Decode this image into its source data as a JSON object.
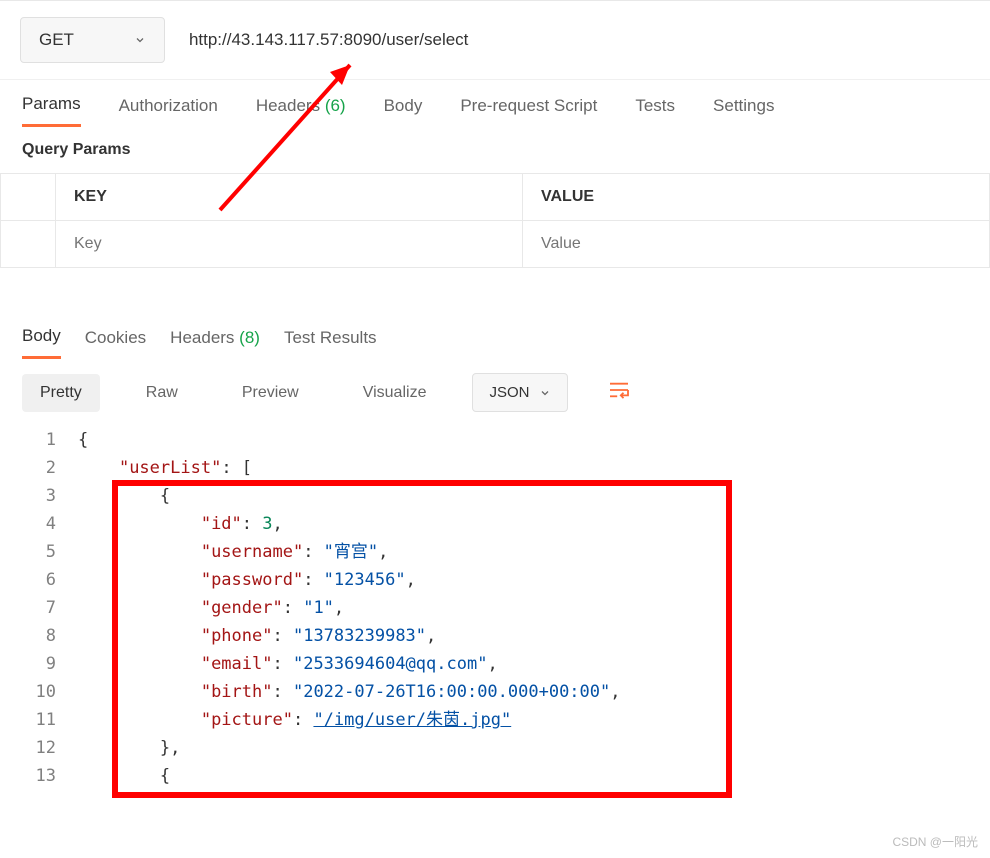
{
  "request": {
    "method": "GET",
    "url": "http://43.143.117.57:8090/user/select"
  },
  "requestTabs": {
    "params": "Params",
    "authorization": "Authorization",
    "headers_label": "Headers",
    "headers_count": "(6)",
    "body": "Body",
    "preRequest": "Pre-request Script",
    "tests": "Tests",
    "settings": "Settings"
  },
  "queryParams": {
    "title": "Query Params",
    "keyHeader": "KEY",
    "valueHeader": "VALUE",
    "keyPlaceholder": "Key",
    "valuePlaceholder": "Value"
  },
  "responseTabs": {
    "body": "Body",
    "cookies": "Cookies",
    "headers_label": "Headers",
    "headers_count": "(8)",
    "testResults": "Test Results"
  },
  "viewBar": {
    "pretty": "Pretty",
    "raw": "Raw",
    "preview": "Preview",
    "visualize": "Visualize",
    "format": "JSON"
  },
  "code": {
    "lines": [
      "1",
      "2",
      "3",
      "4",
      "5",
      "6",
      "7",
      "8",
      "9",
      "10",
      "11",
      "12",
      "13"
    ],
    "k_userList": "\"userList\"",
    "k_id": "\"id\"",
    "v_id": "3",
    "k_username": "\"username\"",
    "v_username": "\"宵宫\"",
    "k_password": "\"password\"",
    "v_password": "\"123456\"",
    "k_gender": "\"gender\"",
    "v_gender": "\"1\"",
    "k_phone": "\"phone\"",
    "v_phone": "\"13783239983\"",
    "k_email": "\"email\"",
    "v_email": "\"2533694604@qq.com\"",
    "k_birth": "\"birth\"",
    "v_birth": "\"2022-07-26T16:00:00.000+00:00\"",
    "k_picture": "\"picture\"",
    "v_picture": "\"/img/user/朱茵.jpg\""
  },
  "watermark": "CSDN @一阳光"
}
